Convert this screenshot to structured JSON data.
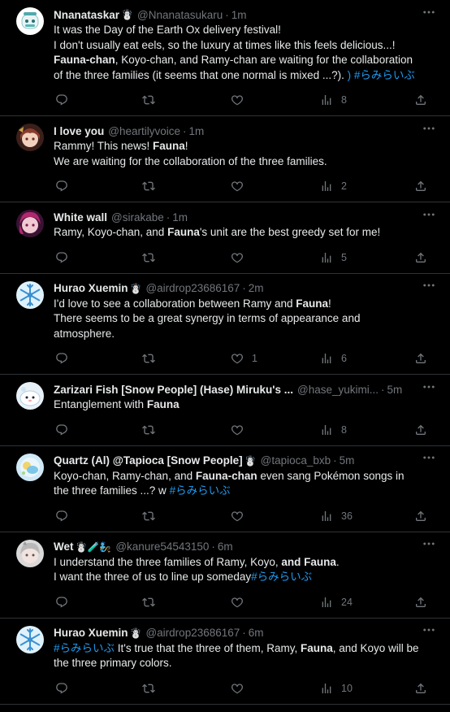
{
  "tweets": [
    {
      "name": "Nnanataskar",
      "emoji": "☃️",
      "handle": "@Nnanatasukaru",
      "time": "1m",
      "lines": [
        [
          {
            "t": "It was the Day of the Earth Ox delivery festival!"
          }
        ],
        [
          {
            "t": "I don't usually eat eels, so the luxury at times like this feels delicious...!"
          }
        ],
        [
          {
            "t": "Fauna-chan",
            "b": true
          },
          {
            "t": ", Koyo-chan, and Ramy-chan are waiting for the collaboration"
          }
        ],
        [
          {
            "t": "of the three families (it seems that one normal is mixed ...?). "
          },
          {
            "t": ") #らみらいぶ",
            "link": true
          }
        ]
      ],
      "likes": "",
      "views": "8",
      "avatar": "a1"
    },
    {
      "name": "I love you",
      "emoji": "",
      "handle": "@heartilyvoice",
      "time": "1m",
      "lines": [
        [
          {
            "t": "Rammy! This news! "
          },
          {
            "t": "Fauna",
            "b": true
          },
          {
            "t": "!"
          }
        ],
        [
          {
            "t": "We are waiting for the collaboration of the three families."
          }
        ]
      ],
      "likes": "",
      "views": "2",
      "avatar": "a2"
    },
    {
      "name": "White wall",
      "emoji": "",
      "handle": "@sirakabe",
      "time": "1m",
      "lines": [
        [
          {
            "t": "Ramy, Koyo-chan, and "
          },
          {
            "t": "Fauna",
            "b": true
          },
          {
            "t": "'s unit are the best greedy set for me!"
          }
        ]
      ],
      "likes": "",
      "views": "5",
      "avatar": "a3"
    },
    {
      "name": "Hurao Xuemin",
      "emoji": "☃️",
      "handle": "@airdrop23686167",
      "time": "2m",
      "lines": [
        [
          {
            "t": "I'd love to see a collaboration between Ramy and "
          },
          {
            "t": "Fauna",
            "b": true
          },
          {
            "t": "!"
          }
        ],
        [
          {
            "t": "There seems to be a great synergy in terms of appearance and"
          }
        ],
        [
          {
            "t": "atmosphere."
          }
        ]
      ],
      "likes": "1",
      "views": "6",
      "avatar": "a4"
    },
    {
      "name": "Zarizari Fish [Snow People] (Hase) Miruku's ...",
      "emoji": "",
      "handle": "@hase_yukimi...",
      "time": "5m",
      "lines": [
        [
          {
            "t": "Entanglement with "
          },
          {
            "t": "Fauna",
            "b": true
          }
        ]
      ],
      "likes": "",
      "views": "8",
      "avatar": "a5"
    },
    {
      "name": "Quartz (Al) @Tapioca [Snow People]",
      "emoji": "☃️",
      "handle": "@tapioca_bxb",
      "time": "5m",
      "lines": [
        [
          {
            "t": "Koyo-chan, Ramy-chan, and "
          },
          {
            "t": "Fauna-chan",
            "b": true
          },
          {
            "t": " even sang Pokémon songs in"
          }
        ],
        [
          {
            "t": "the three families ...? w "
          },
          {
            "t": "#らみらいぶ",
            "link": true
          }
        ]
      ],
      "likes": "",
      "views": "36",
      "avatar": "a6"
    },
    {
      "name": "Wet",
      "emoji": "☃️🧪🧞",
      "handle": "@kanure54543150",
      "time": "6m",
      "lines": [
        [
          {
            "t": "I understand the three families of Ramy, Koyo, "
          },
          {
            "t": "and Fauna",
            "b": true
          },
          {
            "t": "."
          }
        ],
        [
          {
            "t": "I want the three of us to line up someday"
          },
          {
            "t": "#らみらいぶ",
            "link": true
          }
        ]
      ],
      "likes": "",
      "views": "24",
      "avatar": "a7"
    },
    {
      "name": "Hurao Xuemin",
      "emoji": "☃️",
      "handle": "@airdrop23686167",
      "time": "6m",
      "lines": [
        [
          {
            "t": "#らみらいぶ",
            "link": true
          },
          {
            "t": " It's true that the three of them, Ramy, "
          },
          {
            "t": "Fauna",
            "b": true
          },
          {
            "t": ", and Koyo will be"
          }
        ],
        [
          {
            "t": "the three primary colors."
          }
        ]
      ],
      "likes": "",
      "views": "10",
      "avatar": "a4"
    }
  ],
  "colors": {
    "background": "#000000",
    "text": "#e7e9ea",
    "muted": "#71767b",
    "link": "#1d9bf0",
    "divider": "#2f3336"
  },
  "icons": {
    "reply": "reply-icon",
    "retweet": "retweet-icon",
    "like": "heart-icon",
    "views": "views-icon",
    "share": "share-icon",
    "more": "more-icon"
  }
}
